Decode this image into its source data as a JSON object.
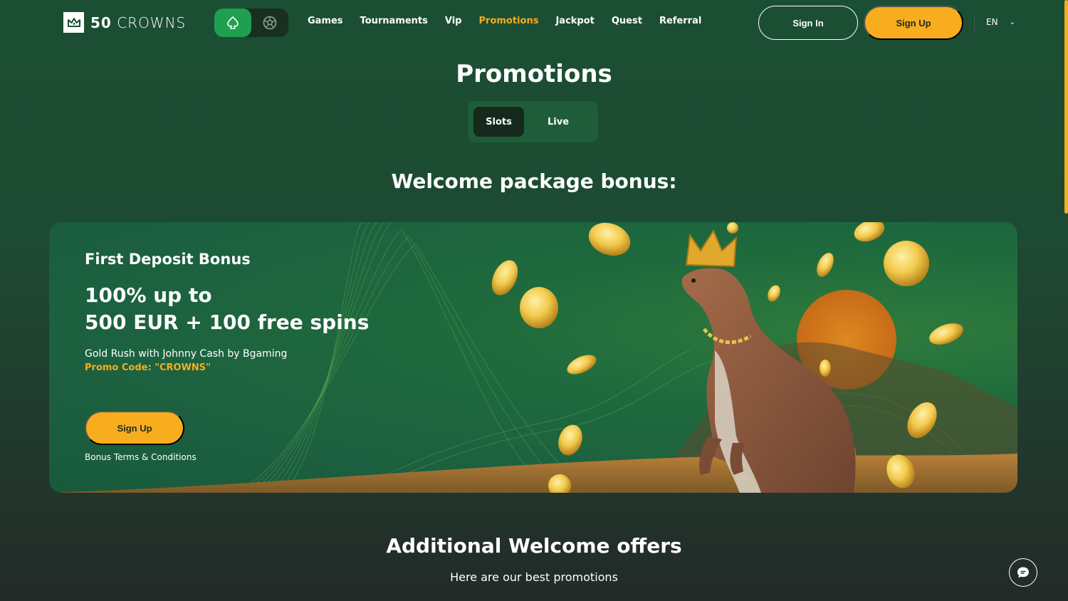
{
  "brand": {
    "name_bold": "50",
    "name_light": "CROWNS"
  },
  "mode_switch": {
    "casino_icon": "spade-icon",
    "sports_icon": "soccer-ball-icon"
  },
  "nav": {
    "items": [
      {
        "label": "Games",
        "active": false
      },
      {
        "label": "Tournaments",
        "active": false
      },
      {
        "label": "Vip",
        "active": false
      },
      {
        "label": "Promotions",
        "active": true
      },
      {
        "label": "Jackpot",
        "active": false
      },
      {
        "label": "Quest",
        "active": false
      },
      {
        "label": "Referral",
        "active": false
      }
    ]
  },
  "auth": {
    "sign_in": "Sign In",
    "sign_up": "Sign Up"
  },
  "language": {
    "current": "EN"
  },
  "page": {
    "title": "Promotions",
    "tabs": [
      {
        "label": "Slots",
        "active": true
      },
      {
        "label": "Live",
        "active": false
      }
    ],
    "welcome_title": "Welcome package bonus:"
  },
  "banner": {
    "label": "First Deposit Bonus",
    "headline_line1": "100% up to",
    "headline_line2": "500 EUR + 100 free spins",
    "game": "Gold Rush with Johnny Cash by Bgaming",
    "promo": "Promo Code: \"CROWNS\"",
    "cta": "Sign Up",
    "terms": "Bonus Terms & Conditions",
    "illustration": "crowned-kangaroo-with-gold-coins"
  },
  "additional": {
    "title": "Additional Welcome offers",
    "subtitle": "Here are our best promotions"
  },
  "colors": {
    "accent": "#f7ad1e",
    "green_active": "#1fa050",
    "banner_green": "#1c6040"
  }
}
